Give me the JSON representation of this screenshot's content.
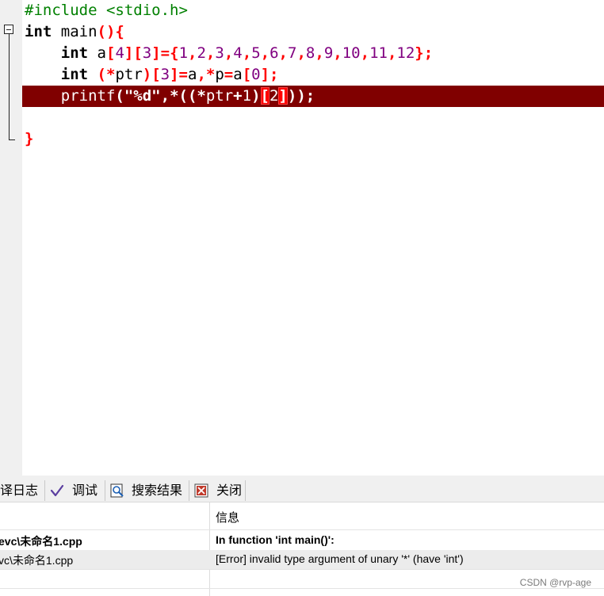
{
  "editor": {
    "lines": [
      {
        "tokens": [
          {
            "t": "#include <stdio.h>",
            "c": "pp"
          }
        ]
      },
      {
        "tokens": [
          {
            "t": "int",
            "c": "kw"
          },
          {
            "t": " main",
            "c": "id"
          },
          {
            "t": "(){",
            "c": "sym"
          }
        ]
      },
      {
        "tokens": [
          {
            "t": "    ",
            "c": "id"
          },
          {
            "t": "int",
            "c": "kw"
          },
          {
            "t": " a",
            "c": "id"
          },
          {
            "t": "[",
            "c": "sym"
          },
          {
            "t": "4",
            "c": "num"
          },
          {
            "t": "][",
            "c": "sym"
          },
          {
            "t": "3",
            "c": "num"
          },
          {
            "t": "]={",
            "c": "sym"
          },
          {
            "t": "1",
            "c": "num"
          },
          {
            "t": ",",
            "c": "sym"
          },
          {
            "t": "2",
            "c": "num"
          },
          {
            "t": ",",
            "c": "sym"
          },
          {
            "t": "3",
            "c": "num"
          },
          {
            "t": ",",
            "c": "sym"
          },
          {
            "t": "4",
            "c": "num"
          },
          {
            "t": ",",
            "c": "sym"
          },
          {
            "t": "5",
            "c": "num"
          },
          {
            "t": ",",
            "c": "sym"
          },
          {
            "t": "6",
            "c": "num"
          },
          {
            "t": ",",
            "c": "sym"
          },
          {
            "t": "7",
            "c": "num"
          },
          {
            "t": ",",
            "c": "sym"
          },
          {
            "t": "8",
            "c": "num"
          },
          {
            "t": ",",
            "c": "sym"
          },
          {
            "t": "9",
            "c": "num"
          },
          {
            "t": ",",
            "c": "sym"
          },
          {
            "t": "10",
            "c": "num"
          },
          {
            "t": ",",
            "c": "sym"
          },
          {
            "t": "11",
            "c": "num"
          },
          {
            "t": ",",
            "c": "sym"
          },
          {
            "t": "12",
            "c": "num"
          },
          {
            "t": "};",
            "c": "sym"
          }
        ]
      },
      {
        "tokens": [
          {
            "t": "    ",
            "c": "id"
          },
          {
            "t": "int",
            "c": "kw"
          },
          {
            "t": " ",
            "c": "id"
          },
          {
            "t": "(*",
            "c": "sym"
          },
          {
            "t": "ptr",
            "c": "id"
          },
          {
            "t": ")[",
            "c": "sym"
          },
          {
            "t": "3",
            "c": "num"
          },
          {
            "t": "]=",
            "c": "sym"
          },
          {
            "t": "a",
            "c": "id"
          },
          {
            "t": ",*",
            "c": "sym"
          },
          {
            "t": "p",
            "c": "id"
          },
          {
            "t": "=",
            "c": "sym"
          },
          {
            "t": "a",
            "c": "id"
          },
          {
            "t": "[",
            "c": "sym"
          },
          {
            "t": "0",
            "c": "num"
          },
          {
            "t": "];",
            "c": "sym"
          }
        ]
      },
      {
        "tokens": [
          {
            "t": "    ",
            "c": "id"
          },
          {
            "t": "printf",
            "c": "id"
          },
          {
            "t": "(",
            "c": "sym"
          },
          {
            "t": "\"%d\"",
            "c": "str"
          },
          {
            "t": ",*((*",
            "c": "sym"
          },
          {
            "t": "ptr",
            "c": "id"
          },
          {
            "t": "+",
            "c": "sym"
          },
          {
            "t": "1",
            "c": "num"
          },
          {
            "t": ")",
            "c": "sym"
          },
          {
            "t": "[",
            "c": "sym mbox"
          },
          {
            "t": "2",
            "c": "num"
          },
          {
            "t": "]",
            "c": "sym mbox"
          },
          {
            "t": "));",
            "c": "sym"
          }
        ],
        "highlight": true
      },
      {
        "tokens": []
      },
      {
        "tokens": [
          {
            "t": "}",
            "c": "sym"
          }
        ]
      }
    ]
  },
  "panel": {
    "tabs": [
      "译日志",
      "调试",
      "搜索结果",
      "关闭"
    ],
    "column_header": "信息",
    "rows": [
      {
        "file": "evc\\未命名1.cpp",
        "message": "In function 'int main()':",
        "bold": true
      },
      {
        "file": "vc\\未命名1.cpp",
        "message": "[Error] invalid type argument of unary '*' (have 'int')",
        "bold": false
      }
    ],
    "watermark": "CSDN @rvp-age"
  }
}
